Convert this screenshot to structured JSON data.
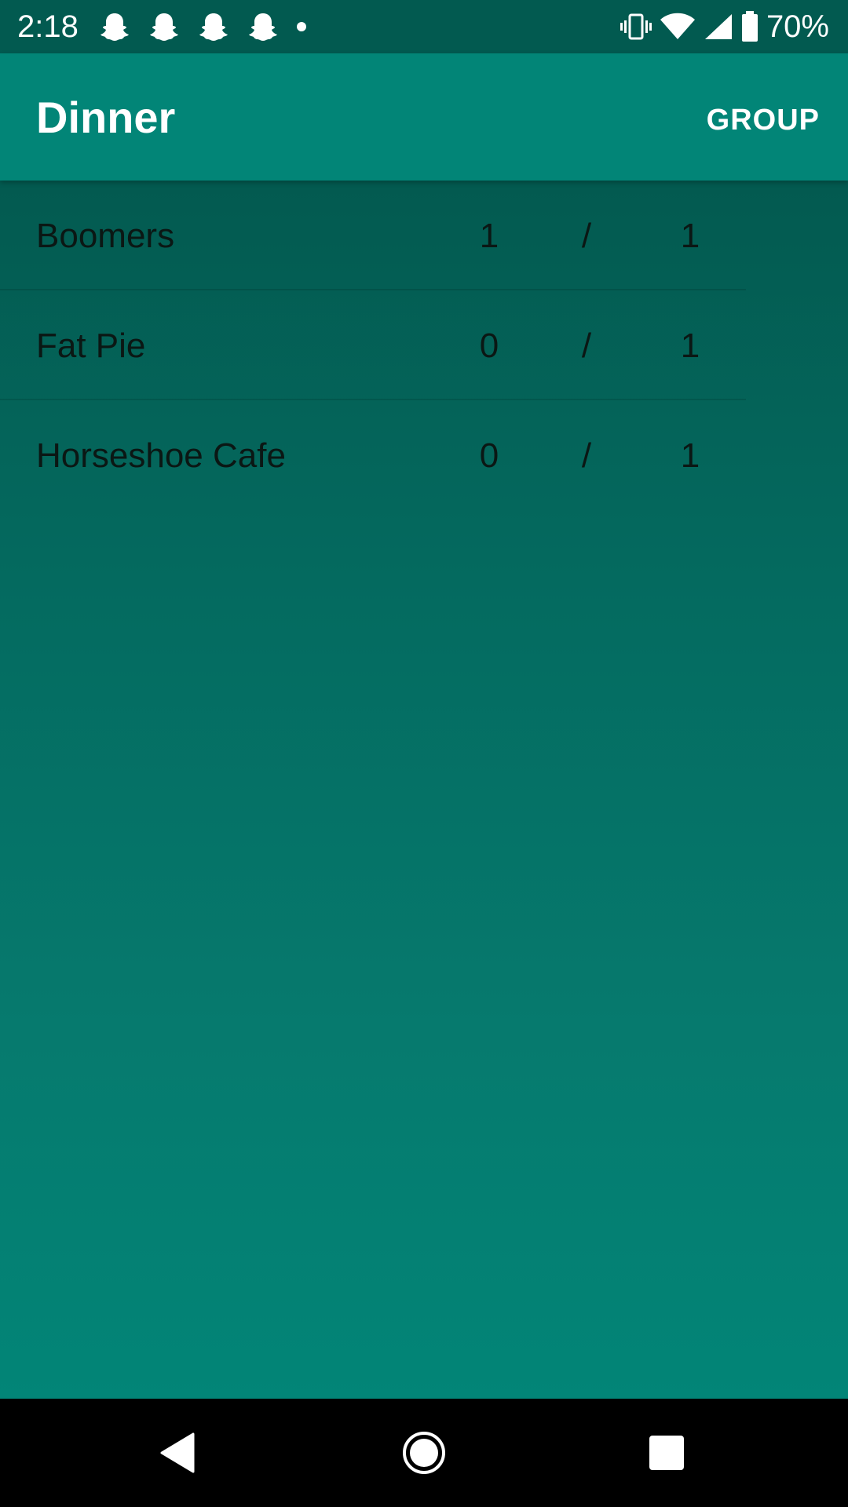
{
  "status_bar": {
    "time": "2:18",
    "notification_icons": [
      "snapchat-icon",
      "snapchat-icon",
      "snapchat-icon",
      "snapchat-icon"
    ],
    "more_notifications_icon": "dot-icon",
    "system_icons": [
      "vibrate-icon",
      "wifi-icon",
      "cell-signal-icon",
      "battery-icon"
    ],
    "battery_percent": "70%"
  },
  "app_bar": {
    "title": "Dinner",
    "action_label": "GROUP",
    "color": "#028577"
  },
  "list": {
    "items": [
      {
        "name": "Boomers",
        "count": "1",
        "separator": "/",
        "total": "1"
      },
      {
        "name": "Fat Pie",
        "count": "0",
        "separator": "/",
        "total": "1"
      },
      {
        "name": "Horseshoe Cafe",
        "count": "0",
        "separator": "/",
        "total": "1"
      }
    ]
  },
  "nav_bar": {
    "buttons": [
      "back-icon",
      "home-icon",
      "recents-icon"
    ]
  },
  "colors": {
    "status_bar": "#025a50",
    "primary": "#028577",
    "content_top": "#035a50",
    "text_dark": "#0b1714"
  }
}
